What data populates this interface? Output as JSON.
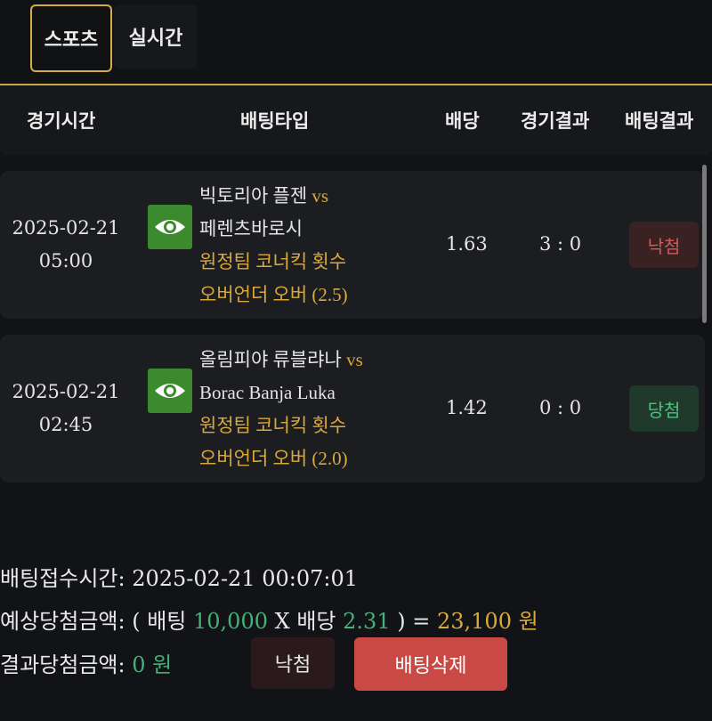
{
  "tabs": [
    {
      "label": "스포츠",
      "active": true
    },
    {
      "label": "실시간",
      "active": false
    }
  ],
  "table_header": {
    "time": "경기시간",
    "bet_type": "배팅타입",
    "odds": "배당",
    "game_result": "경기결과",
    "bet_result": "배팅결과"
  },
  "rows": [
    {
      "date": "2025-02-21",
      "time": "05:00",
      "home": "빅토리아 플젠",
      "vs": "vs",
      "away": "페렌츠바로시",
      "market_line1": "원정팀 코너킥 횟수",
      "market_line2": "오버언더 오버 (2.5)",
      "odds": "1.63",
      "score": "3 : 0",
      "result": "낙첨",
      "result_type": "lose"
    },
    {
      "date": "2025-02-21",
      "time": "02:45",
      "home": "올림피야 류블랴나",
      "vs": "vs",
      "away": "Borac Banja Luka",
      "market_line1": "원정팀 코너킥 횟수",
      "market_line2": "오버언더 오버 (2.0)",
      "odds": "1.42",
      "score": "0 : 0",
      "result": "당첨",
      "result_type": "win"
    }
  ],
  "summary": {
    "received_label": "배팅접수시간:",
    "received_value": "2025-02-21 00:07:01",
    "expected_label": "예상당첨금액:",
    "expected_open": "( 배팅",
    "bet_amount": "10,000",
    "times": "X 배당",
    "total_odds": "2.31",
    "expected_close": ") =",
    "expected_win": "23,100 원",
    "result_label": "결과당첨금액:",
    "result_value": "0 원"
  },
  "buttons": {
    "lose_label": "낙첨",
    "delete_label": "배팅삭제"
  },
  "colors": {
    "accent_gold": "#d9a93c",
    "win_green": "#44b07a",
    "lose_red": "#d45a5a",
    "delete_red": "#c94a45",
    "eye_green": "#3c8a2e"
  }
}
